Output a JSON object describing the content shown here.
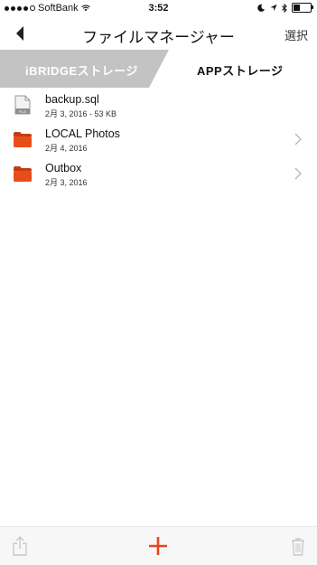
{
  "status_bar": {
    "carrier": "SoftBank",
    "time": "3:52",
    "signal_bars": 4,
    "battery_level": 0.3
  },
  "nav": {
    "title": "ファイルマネージャー",
    "select_label": "選択"
  },
  "tabs": {
    "left_label": "iBRIDGEストレージ",
    "right_label": "APPストレージ",
    "active": "right"
  },
  "files": [
    {
      "name": "backup.sql",
      "meta": "2月 3, 2016 - 53 KB",
      "type": "file",
      "badge": "FILE"
    },
    {
      "name": "LOCAL Photos",
      "meta": "2月 4, 2016",
      "type": "folder"
    },
    {
      "name": "Outbox",
      "meta": "2月 3, 2016",
      "type": "folder"
    }
  ],
  "colors": {
    "accent": "#e8451e",
    "folder": "#e84e1b",
    "tab_inactive": "#c3c3c3"
  }
}
